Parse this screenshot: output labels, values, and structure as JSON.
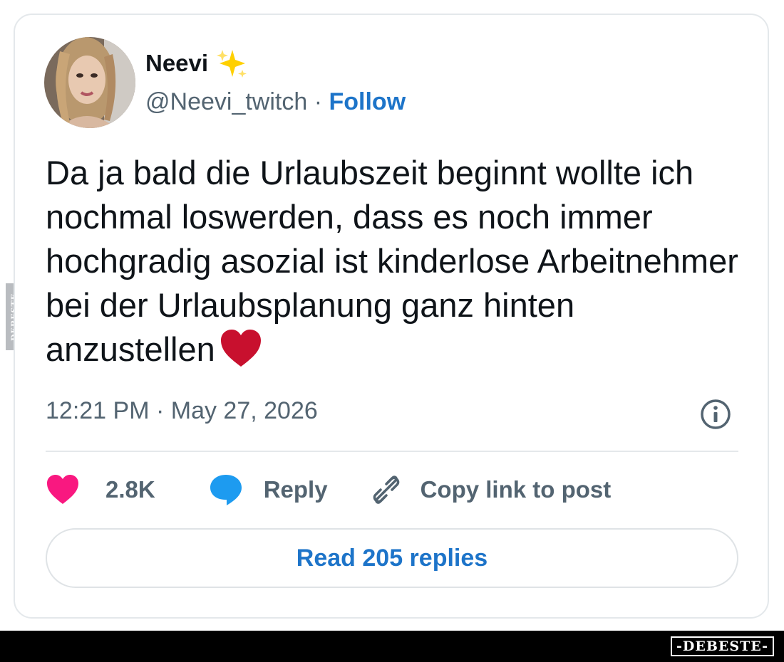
{
  "watermark": {
    "side_text": "DEBESTE",
    "footer_text": "-DEBESTE-"
  },
  "user": {
    "name": "Neevi",
    "handle": "@Neevi_twitch",
    "separator": "·",
    "follow_label": "Follow",
    "avatar_icon": "profile-photo",
    "name_emoji": "sparkles-icon"
  },
  "tweet": {
    "text": "Da ja bald die Urlaubszeit beginnt wollte ich nochmal loswerden, dass es noch immer hochgradig asozial ist kinderlose Arbeitnehmer bei der Urlaubsplanung ganz hinten anzustellen",
    "trailing_emoji": "red-heart-icon",
    "timestamp": "12:21 PM · May 27, 2026"
  },
  "actions": {
    "likes_count": "2.8K",
    "reply_label": "Reply",
    "copy_link_label": "Copy link to post"
  },
  "read_replies_label": "Read 205 replies",
  "colors": {
    "link_blue": "#1d74c9",
    "like_pink": "#f91880",
    "reply_blue": "#1d9bf0",
    "heart_red": "#c8102e",
    "sparkle_yellow": "#ffd000",
    "secondary_text": "#536471"
  }
}
